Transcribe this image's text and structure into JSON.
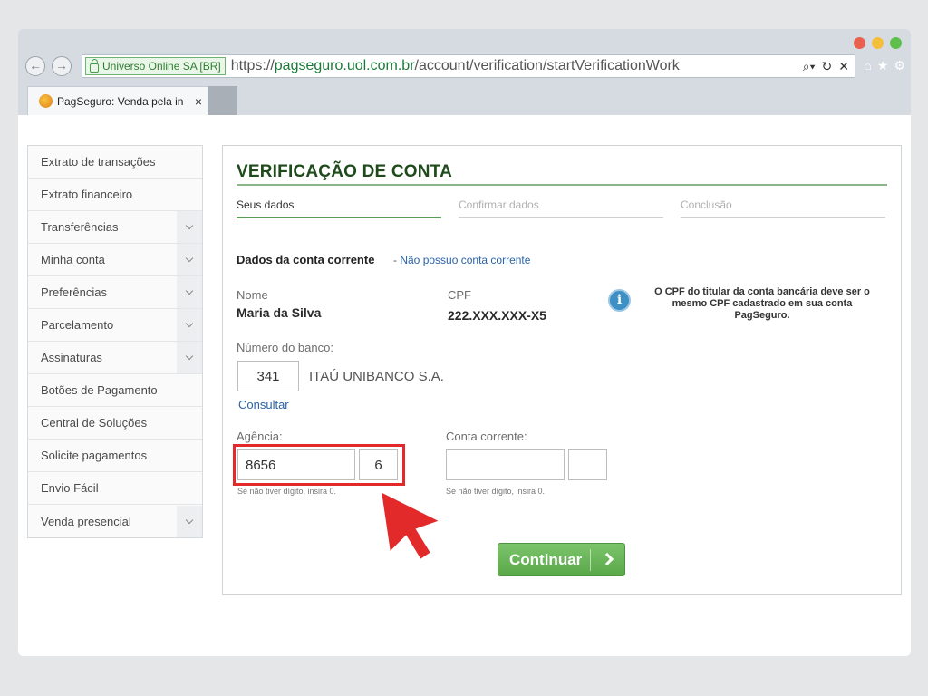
{
  "browser": {
    "traffic_colors": [
      "#e9614e",
      "#f4be3a",
      "#5cc04a"
    ],
    "secure_label": "Universo Online SA [BR]",
    "url_scheme": "https://",
    "url_host": "pagseguro.uol.com.br",
    "url_path": "/account/verification/startVerificationWork",
    "tab_title": "PagSeguro: Venda pela in",
    "tab_close": "×"
  },
  "sidebar": {
    "items": [
      {
        "label": "Extrato de transações",
        "has_submenu": false
      },
      {
        "label": "Extrato financeiro",
        "has_submenu": false
      },
      {
        "label": "Transferências",
        "has_submenu": true
      },
      {
        "label": "Minha conta",
        "has_submenu": true
      },
      {
        "label": "Preferências",
        "has_submenu": true
      },
      {
        "label": "Parcelamento",
        "has_submenu": true
      },
      {
        "label": "Assinaturas",
        "has_submenu": true
      },
      {
        "label": "Botões de Pagamento",
        "has_submenu": false
      },
      {
        "label": "Central de Soluções",
        "has_submenu": false
      },
      {
        "label": "Solicite pagamentos",
        "has_submenu": false
      },
      {
        "label": "Envio Fácil",
        "has_submenu": false
      },
      {
        "label": "Venda presencial",
        "has_submenu": true
      }
    ]
  },
  "main": {
    "title": "VERIFICAÇÃO DE CONTA",
    "steps": [
      "Seus dados",
      "Confirmar dados",
      "Conclusão"
    ],
    "active_step": 0,
    "section_head": "Dados da conta corrente",
    "section_sep": "-",
    "section_link": "Não possuo conta corrente",
    "name_label": "Nome",
    "name_value": "Maria da Silva",
    "cpf_label": "CPF",
    "cpf_value": "222.XXX.XXX-X5",
    "info_text": "O CPF do titular da conta bancária deve ser o mesmo CPF cadastrado em sua conta PagSeguro.",
    "bank_label": "Número do banco:",
    "bank_number": "341",
    "bank_name": "ITAÚ UNIBANCO S.A.",
    "consultar": "Consultar",
    "agencia_label": "Agência:",
    "agencia_value": "8656",
    "agencia_digit": "6",
    "agencia_hint": "Se não tiver dígito, insira 0.",
    "conta_label": "Conta corrente:",
    "conta_value": "",
    "conta_digit": "",
    "conta_hint": "Se não tiver dígito, insira 0.",
    "continue_label": "Continuar"
  },
  "colors": {
    "accent_green": "#5aa849",
    "title_green": "#1e4a1c",
    "link_blue": "#2b63a8",
    "highlight_red": "#e32a2a"
  }
}
